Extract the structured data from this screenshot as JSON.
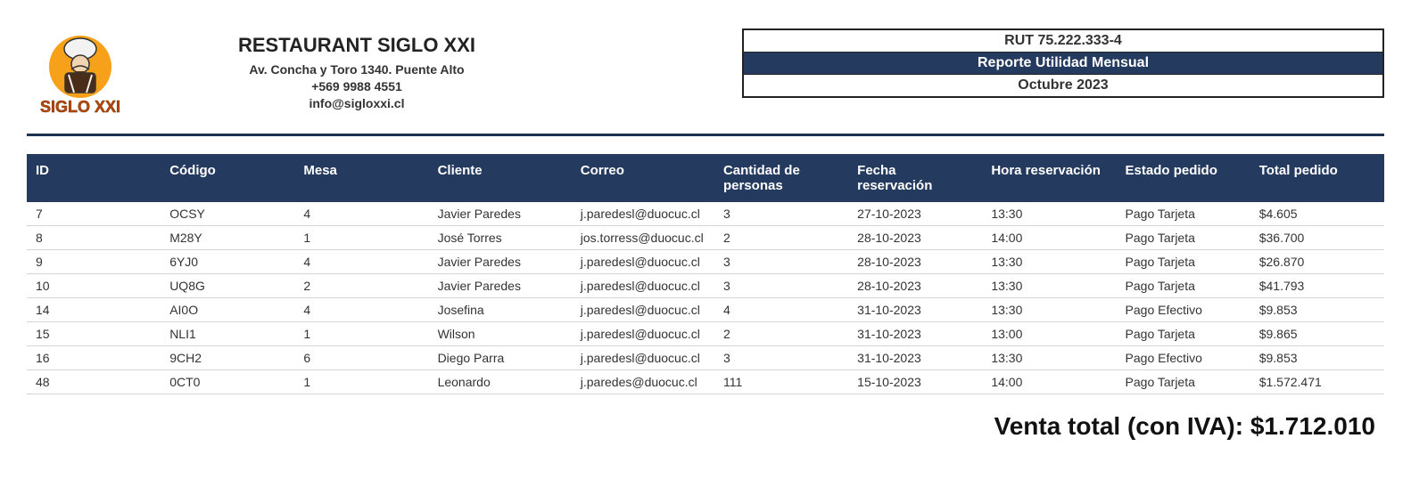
{
  "company": {
    "name": "RESTAURANT SIGLO XXI",
    "address": "Av. Concha y Toro 1340. Puente Alto",
    "phone": "+569 9988 4551",
    "email": "info@sigloxxi.cl",
    "logo_text": "SIGLO XXI"
  },
  "report": {
    "rut": "RUT 75.222.333-4",
    "title": "Reporte Utilidad Mensual",
    "period": "Octubre 2023"
  },
  "table": {
    "headers": {
      "id": "ID",
      "codigo": "Código",
      "mesa": "Mesa",
      "cliente": "Cliente",
      "correo": "Correo",
      "cantidad": "Cantidad de personas",
      "fecha": "Fecha reservación",
      "hora": "Hora reservación",
      "estado": "Estado pedido",
      "total": "Total pedido"
    },
    "rows": [
      {
        "id": "7",
        "codigo": "OCSY",
        "mesa": "4",
        "cliente": "Javier Paredes",
        "correo": "j.paredesl@duocuc.cl",
        "cantidad": "3",
        "fecha": "27-10-2023",
        "hora": "13:30",
        "estado": "Pago Tarjeta",
        "total": "$4.605"
      },
      {
        "id": "8",
        "codigo": "M28Y",
        "mesa": "1",
        "cliente": "José Torres",
        "correo": "jos.torress@duocuc.cl",
        "cantidad": "2",
        "fecha": "28-10-2023",
        "hora": "14:00",
        "estado": "Pago Tarjeta",
        "total": "$36.700"
      },
      {
        "id": "9",
        "codigo": "6YJ0",
        "mesa": "4",
        "cliente": "Javier Paredes",
        "correo": "j.paredesl@duocuc.cl",
        "cantidad": "3",
        "fecha": "28-10-2023",
        "hora": "13:30",
        "estado": "Pago Tarjeta",
        "total": "$26.870"
      },
      {
        "id": "10",
        "codigo": "UQ8G",
        "mesa": "2",
        "cliente": "Javier Paredes",
        "correo": "j.paredesl@duocuc.cl",
        "cantidad": "3",
        "fecha": "28-10-2023",
        "hora": "13:30",
        "estado": "Pago Tarjeta",
        "total": "$41.793"
      },
      {
        "id": "14",
        "codigo": "AI0O",
        "mesa": "4",
        "cliente": "Josefina",
        "correo": "j.paredesl@duocuc.cl",
        "cantidad": "4",
        "fecha": "31-10-2023",
        "hora": "13:30",
        "estado": "Pago Efectivo",
        "total": "$9.853"
      },
      {
        "id": "15",
        "codigo": "NLI1",
        "mesa": "1",
        "cliente": "Wilson",
        "correo": "j.paredesl@duocuc.cl",
        "cantidad": "2",
        "fecha": "31-10-2023",
        "hora": "13:00",
        "estado": "Pago Tarjeta",
        "total": "$9.865"
      },
      {
        "id": "16",
        "codigo": "9CH2",
        "mesa": "6",
        "cliente": "Diego Parra",
        "correo": "j.paredesl@duocuc.cl",
        "cantidad": "3",
        "fecha": "31-10-2023",
        "hora": "13:30",
        "estado": "Pago Efectivo",
        "total": "$9.853"
      },
      {
        "id": "48",
        "codigo": "0CT0",
        "mesa": "1",
        "cliente": "Leonardo",
        "correo": "j.paredes@duocuc.cl",
        "cantidad": "111",
        "fecha": "15-10-2023",
        "hora": "14:00",
        "estado": "Pago Tarjeta",
        "total": "$1.572.471"
      }
    ]
  },
  "summary": {
    "label": "Venta total (con IVA): ",
    "value": "$1.712.010"
  }
}
